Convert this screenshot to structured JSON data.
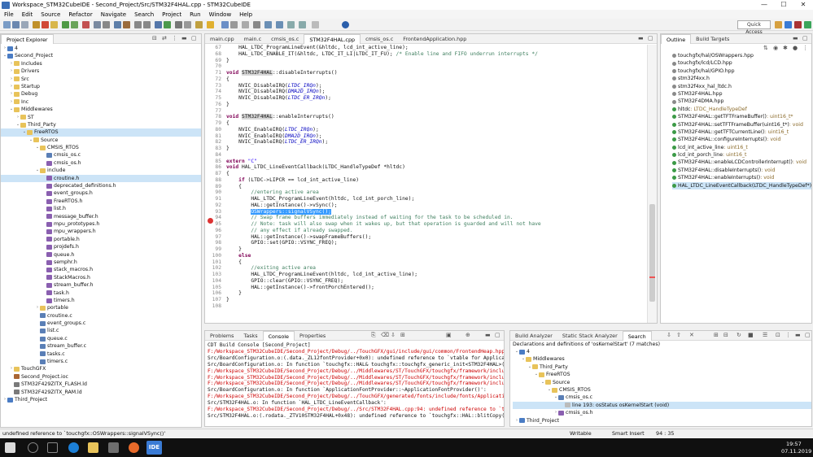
{
  "window": {
    "title": "Workspace_STM32CubeIDE - Second_Project/Src/STM32F4HAL.cpp - STM32CubeIDE",
    "controls": [
      "—",
      "☐",
      "✕"
    ]
  },
  "menu": [
    "File",
    "Edit",
    "Source",
    "Refactor",
    "Navigate",
    "Search",
    "Project",
    "Run",
    "Window",
    "Help"
  ],
  "quick_access": "Quick Access",
  "project_explorer": {
    "tab": "Project Explorer",
    "items": [
      {
        "label": "4",
        "depth": 0,
        "tw": "›",
        "icon": "i-proj"
      },
      {
        "label": "Second_Project",
        "depth": 0,
        "tw": "⌄",
        "icon": "i-proj"
      },
      {
        "label": "Includes",
        "depth": 1,
        "tw": "›",
        "icon": "i-folder"
      },
      {
        "label": "Drivers",
        "depth": 1,
        "tw": "›",
        "icon": "i-folder"
      },
      {
        "label": "Src",
        "depth": 1,
        "tw": "›",
        "icon": "i-folder"
      },
      {
        "label": "Startup",
        "depth": 1,
        "tw": "›",
        "icon": "i-folder"
      },
      {
        "label": "Debug",
        "depth": 1,
        "tw": "›",
        "icon": "i-folder"
      },
      {
        "label": "Inc",
        "depth": 1,
        "tw": "›",
        "icon": "i-folder"
      },
      {
        "label": "Middlewares",
        "depth": 1,
        "tw": "⌄",
        "icon": "i-folder"
      },
      {
        "label": "ST",
        "depth": 2,
        "tw": "›",
        "icon": "i-folder"
      },
      {
        "label": "Third_Party",
        "depth": 2,
        "tw": "⌄",
        "icon": "i-folder"
      },
      {
        "label": "FreeRTOS",
        "depth": 3,
        "tw": "⌄",
        "icon": "i-folder",
        "sel": true
      },
      {
        "label": "Source",
        "depth": 4,
        "tw": "⌄",
        "icon": "i-folder"
      },
      {
        "label": "CMSIS_RTOS",
        "depth": 5,
        "tw": "⌄",
        "icon": "i-folder"
      },
      {
        "label": "cmsis_os.c",
        "depth": 6,
        "tw": "",
        "icon": "i-c"
      },
      {
        "label": "cmsis_os.h",
        "depth": 6,
        "tw": "",
        "icon": "i-h"
      },
      {
        "label": "include",
        "depth": 5,
        "tw": "⌄",
        "icon": "i-folder"
      },
      {
        "label": "croutine.h",
        "depth": 6,
        "tw": "",
        "icon": "i-h",
        "sel": true
      },
      {
        "label": "deprecated_definitions.h",
        "depth": 6,
        "tw": "",
        "icon": "i-h"
      },
      {
        "label": "event_groups.h",
        "depth": 6,
        "tw": "",
        "icon": "i-h"
      },
      {
        "label": "FreeRTOS.h",
        "depth": 6,
        "tw": "",
        "icon": "i-h"
      },
      {
        "label": "list.h",
        "depth": 6,
        "tw": "",
        "icon": "i-h"
      },
      {
        "label": "message_buffer.h",
        "depth": 6,
        "tw": "",
        "icon": "i-h"
      },
      {
        "label": "mpu_prototypes.h",
        "depth": 6,
        "tw": "",
        "icon": "i-h"
      },
      {
        "label": "mpu_wrappers.h",
        "depth": 6,
        "tw": "",
        "icon": "i-h"
      },
      {
        "label": "portable.h",
        "depth": 6,
        "tw": "",
        "icon": "i-h"
      },
      {
        "label": "projdefs.h",
        "depth": 6,
        "tw": "",
        "icon": "i-h"
      },
      {
        "label": "queue.h",
        "depth": 6,
        "tw": "",
        "icon": "i-h"
      },
      {
        "label": "semphr.h",
        "depth": 6,
        "tw": "",
        "icon": "i-h"
      },
      {
        "label": "stack_macros.h",
        "depth": 6,
        "tw": "",
        "icon": "i-h"
      },
      {
        "label": "StackMacros.h",
        "depth": 6,
        "tw": "",
        "icon": "i-h"
      },
      {
        "label": "stream_buffer.h",
        "depth": 6,
        "tw": "",
        "icon": "i-h"
      },
      {
        "label": "task.h",
        "depth": 6,
        "tw": "",
        "icon": "i-h"
      },
      {
        "label": "timers.h",
        "depth": 6,
        "tw": "",
        "icon": "i-h"
      },
      {
        "label": "portable",
        "depth": 5,
        "tw": "›",
        "icon": "i-folder"
      },
      {
        "label": "croutine.c",
        "depth": 5,
        "tw": "",
        "icon": "i-c"
      },
      {
        "label": "event_groups.c",
        "depth": 5,
        "tw": "",
        "icon": "i-c"
      },
      {
        "label": "list.c",
        "depth": 5,
        "tw": "",
        "icon": "i-c"
      },
      {
        "label": "queue.c",
        "depth": 5,
        "tw": "",
        "icon": "i-c"
      },
      {
        "label": "stream_buffer.c",
        "depth": 5,
        "tw": "",
        "icon": "i-c"
      },
      {
        "label": "tasks.c",
        "depth": 5,
        "tw": "",
        "icon": "i-c"
      },
      {
        "label": "timers.c",
        "depth": 5,
        "tw": "",
        "icon": "i-c"
      },
      {
        "label": "TouchGFX",
        "depth": 1,
        "tw": "›",
        "icon": "i-folder"
      },
      {
        "label": "Second_Project.ioc",
        "depth": 1,
        "tw": "",
        "icon": "i-bin"
      },
      {
        "label": "STM32F429ZITX_FLASH.ld",
        "depth": 1,
        "tw": "",
        "icon": "i-ld"
      },
      {
        "label": "STM32F429ZITX_RAM.ld",
        "depth": 1,
        "tw": "",
        "icon": "i-ld"
      },
      {
        "label": "Third_Project",
        "depth": 0,
        "tw": "›",
        "icon": "i-proj"
      }
    ]
  },
  "editor": {
    "tabs": [
      {
        "label": "main.cpp",
        "active": false
      },
      {
        "label": "main.c",
        "active": false
      },
      {
        "label": "cmsis_os.c",
        "active": false
      },
      {
        "label": "STM32F4HAL.cpp",
        "active": true
      },
      {
        "label": "cmsis_os.c",
        "active": false
      },
      {
        "label": "FrontendApplication.hpp",
        "active": false
      }
    ],
    "lines": [
      {
        "n": "67",
        "html": "    HAL_LTDC_ProgramLineEvent(&hltdc, lcd_int_active_line);"
      },
      {
        "n": "68",
        "html": "    HAL_LTDC_ENABLE_IT(&hltdc, LTDC_IT_LI|LTDC_IT_FU); <span class=\"cm\">/* Enable line and FIFO underrun interrupts */</span>"
      },
      {
        "n": "69",
        "html": "}"
      },
      {
        "n": "70",
        "html": ""
      },
      {
        "n": "71",
        "html": "<span class=\"kw\">void</span> <span class=\"hl\">STM32F4HAL</span>::disableInterrupts()"
      },
      {
        "n": "72",
        "html": "{"
      },
      {
        "n": "73",
        "html": "    NVIC_DisableIRQ(<span class=\"it\">LTDC_IRQn</span>);"
      },
      {
        "n": "74",
        "html": "    NVIC_DisableIRQ(<span class=\"it\">DMA2D_IRQn</span>);"
      },
      {
        "n": "75",
        "html": "    NVIC_DisableIRQ(<span class=\"it\">LTDC_ER_IRQn</span>);"
      },
      {
        "n": "76",
        "html": "}"
      },
      {
        "n": "77",
        "html": ""
      },
      {
        "n": "78",
        "html": "<span class=\"kw\">void</span> <span class=\"hl\">STM32F4HAL</span>::enableInterrupts()"
      },
      {
        "n": "79",
        "html": "{"
      },
      {
        "n": "80",
        "html": "    NVIC_EnableIRQ(<span class=\"it\">LTDC_IRQn</span>);"
      },
      {
        "n": "81",
        "html": "    NVIC_EnableIRQ(<span class=\"it\">DMA2D_IRQn</span>);"
      },
      {
        "n": "82",
        "html": "    NVIC_EnableIRQ(<span class=\"it\">LTDC_ER_IRQn</span>);"
      },
      {
        "n": "83",
        "html": "}"
      },
      {
        "n": "84",
        "html": ""
      },
      {
        "n": "85",
        "html": "<span class=\"kw\">extern</span> <span style=\"color:#2a00ff\">\"C\"</span>"
      },
      {
        "n": "86",
        "html": "<span class=\"kw\">void</span> HAL_LTDC_LineEventCallback(LTDC_HandleTypeDef *hltdc)"
      },
      {
        "n": "87",
        "html": "{"
      },
      {
        "n": "88",
        "html": "    <span class=\"kw\">if</span> (LTDC->LIPCR == lcd_int_active_line)"
      },
      {
        "n": "89",
        "html": "    {"
      },
      {
        "n": "90",
        "html": "        <span class=\"cm\">//entering active area</span>"
      },
      {
        "n": "91",
        "html": "        HAL_LTDC_ProgramLineEvent(hltdc, lcd_int_porch_line);"
      },
      {
        "n": "92",
        "html": "        HAL::getInstance()->vSync();"
      },
      {
        "n": "93",
        "html": "        <span class=\"sel2\">OSWrappers::signalVSync();</span>"
      },
      {
        "n": "94",
        "html": "        <span class=\"cm\">// Swap frame buffers immediately instead of waiting for the task to be scheduled in.</span>"
      },
      {
        "n": "95",
        "html": "        <span class=\"cm\">// Note: task will also swap when it wakes up, but that operation is guarded and will not have</span>"
      },
      {
        "n": "96",
        "html": "        <span class=\"cm\">// any effect if already swapped.</span>"
      },
      {
        "n": "97",
        "html": "        HAL::getInstance()->swapFrameBuffers();"
      },
      {
        "n": "98",
        "html": "        GPIO::set(GPIO::VSYNC_FREQ);"
      },
      {
        "n": "99",
        "html": "    }"
      },
      {
        "n": "100",
        "html": "    <span class=\"kw\">else</span>"
      },
      {
        "n": "101",
        "html": "    {"
      },
      {
        "n": "102",
        "html": "        <span class=\"cm\">//exiting active area</span>"
      },
      {
        "n": "103",
        "html": "        HAL_LTDC_ProgramLineEvent(hltdc, lcd_int_active_line);"
      },
      {
        "n": "104",
        "html": "        GPIO::clear(GPIO::VSYNC_FREQ);"
      },
      {
        "n": "105",
        "html": "        HAL::getInstance()->frontPorchEntered();"
      },
      {
        "n": "106",
        "html": "    }"
      },
      {
        "n": "107",
        "html": "}"
      },
      {
        "n": "108",
        "html": ""
      }
    ]
  },
  "outline": {
    "tabs": [
      "Outline",
      "Build Targets"
    ],
    "items": [
      {
        "label": "touchgfx/hal/OSWrappers.hpp",
        "type": ""
      },
      {
        "label": "touchgfx/lcd/LCD.hpp",
        "type": ""
      },
      {
        "label": "touchgfx/hal/GPIO.hpp",
        "type": ""
      },
      {
        "label": "stm32f4xx.h",
        "type": ""
      },
      {
        "label": "stm32f4xx_hal_ltdc.h",
        "type": ""
      },
      {
        "label": "STM32F4HAL.hpp",
        "type": ""
      },
      {
        "label": "STM32F4DMA.hpp",
        "type": ""
      },
      {
        "label": "hltdc",
        "type": " : LTDC_HandleTypeDef"
      },
      {
        "label": "STM32F4HAL::getTFTFrameBuffer()",
        "type": " : uint16_t*"
      },
      {
        "label": "STM32F4HAL::setTFTFrameBuffer(uint16_t*)",
        "type": " : void"
      },
      {
        "label": "STM32F4HAL::getTFTCurrentLine()",
        "type": " : uint16_t"
      },
      {
        "label": "STM32F4HAL::configureInterrupts()",
        "type": " : void"
      },
      {
        "label": "lcd_int_active_line",
        "type": " : uint16_t"
      },
      {
        "label": "lcd_int_porch_line",
        "type": " : uint16_t"
      },
      {
        "label": "STM32F4HAL::enableLCDControllerInterrupt()",
        "type": " : void"
      },
      {
        "label": "STM32F4HAL::disableInterrupts()",
        "type": " : void"
      },
      {
        "label": "STM32F4HAL::enableInterrupts()",
        "type": " : void"
      },
      {
        "label": "HAL_LTDC_LineEventCallback(LTDC_HandleTypeDef*)",
        "type": " : v",
        "sel": true
      }
    ]
  },
  "console": {
    "tabs": [
      "Problems",
      "Tasks",
      "Console",
      "Properties"
    ],
    "active": "Console",
    "heading": "CDT Build Console [Second_Project]",
    "lines": [
      {
        "t": "F:/Workspace_STM32CubeIDE/Second_Project/Debug/../TouchGFX/gui/include/gui/common/FrontendHeap.hpp:",
        "err": true
      },
      {
        "t": "Src/BoardConfiguration.o:(.data._ZL12fontProvider+0x0): undefined reference to `vtable for Applicat",
        "err": false
      },
      {
        "t": "Src/BoardConfiguration.o: In function `touchgfx::HAL& touchgfx::touchgfx_generic_init<STM32F4HAL>(t",
        "err": false
      },
      {
        "t": "F:/Workspace_STM32CubeIDE/Second_Project/Debug/../Middlewares/ST/TouchGFX/touchgfx/framework/includ",
        "err": true
      },
      {
        "t": "F:/Workspace_STM32CubeIDE/Second_Project/Debug/../Middlewares/ST/TouchGFX/touchgfx/framework/includ",
        "err": true
      },
      {
        "t": "F:/Workspace_STM32CubeIDE/Second_Project/Debug/../Middlewares/ST/TouchGFX/touchgfx/framework/includ",
        "err": true
      },
      {
        "t": "Src/BoardConfiguration.o: In function `ApplicationFontProvider::~ApplicationFontProvider()':",
        "err": false
      },
      {
        "t": "F:/Workspace_STM32CubeIDE/Second_Project/Debug/../TouchGFX/generated/fonts/include/fonts/Applicatio",
        "err": true
      },
      {
        "t": "Src/STM32F4HAL.o: In function `HAL_LTDC_LineEventCallback':",
        "err": false
      },
      {
        "t": "F:/Workspace_STM32CubeIDE/Second_Project/Debug/../Src/STM32F4HAL.cpp:94: undefined reference to `to",
        "err": true
      },
      {
        "t": "Src/STM32F4HAL.o:(.rodata._ZTV10STM32F4HAL+0x48): undefined reference to `touchgfx::HAL::blitCopy(u",
        "err": false
      }
    ]
  },
  "search": {
    "tabs": [
      "Build Analyzer",
      "Static Stack Analyzer",
      "Search"
    ],
    "active": "Search",
    "heading": "Declarations and definitions of 'osKernelStart' (7 matches)",
    "items": [
      {
        "label": "4",
        "depth": 0,
        "tw": "⌄",
        "icon": "i-proj"
      },
      {
        "label": "Middlewares",
        "depth": 1,
        "tw": "⌄",
        "icon": "i-folder"
      },
      {
        "label": "Third_Party",
        "depth": 2,
        "tw": "⌄",
        "icon": "i-folder"
      },
      {
        "label": "FreeRTOS",
        "depth": 3,
        "tw": "⌄",
        "icon": "i-folder"
      },
      {
        "label": "Source",
        "depth": 4,
        "tw": "⌄",
        "icon": "i-folder"
      },
      {
        "label": "CMSIS_RTOS",
        "depth": 5,
        "tw": "⌄",
        "icon": "i-folder"
      },
      {
        "label": "cmsis_os.c",
        "depth": 6,
        "tw": "⌄",
        "icon": "i-c"
      },
      {
        "label": "line 193: osStatus osKernelStart (void)",
        "depth": 7,
        "tw": "",
        "icon": "i-file",
        "sel": true
      },
      {
        "label": "cmsis_os.h",
        "depth": 6,
        "tw": "›",
        "icon": "i-h"
      },
      {
        "label": "Third_Project",
        "depth": 0,
        "tw": "›",
        "icon": "i-proj"
      }
    ]
  },
  "status": {
    "message": "undefined reference to `touchgfx::OSWrappers::signalVSync()'",
    "writable": "Writable",
    "insert": "Smart Insert",
    "position": "94 : 35"
  },
  "taskbar": {
    "time": "19:57",
    "date": "07.11.2019"
  }
}
